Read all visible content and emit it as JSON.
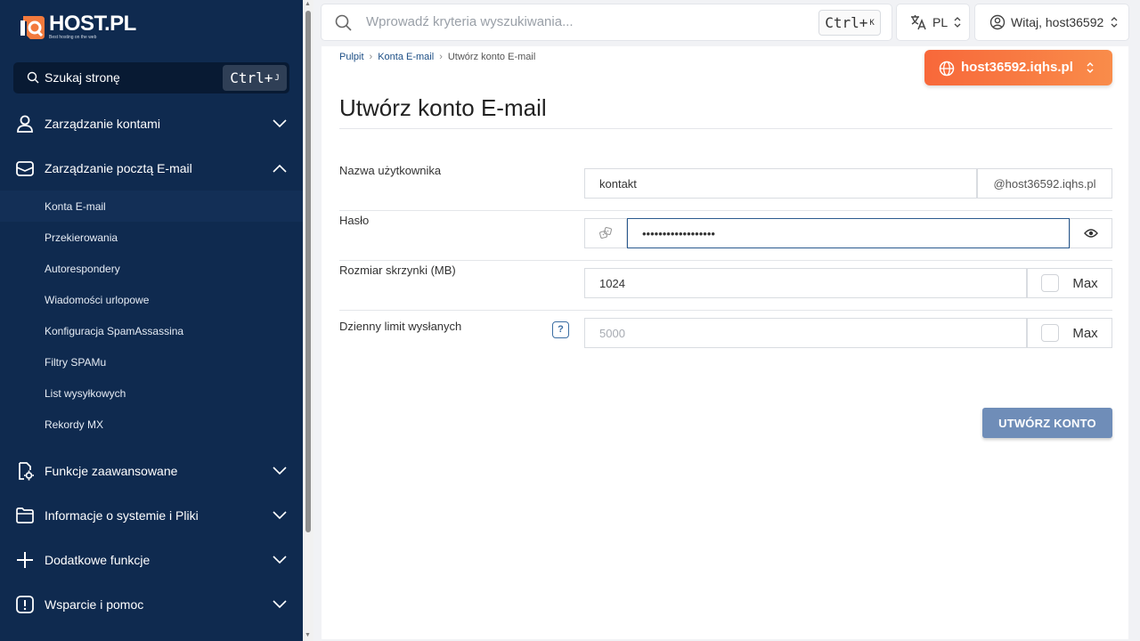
{
  "logo": {
    "name": "HOST.PL",
    "tagline": "Best hosting on the web"
  },
  "sidebar": {
    "search_label": "Szukaj stronę",
    "search_shortcut": "Ctrl+",
    "search_shortcut_key": "J",
    "sections": [
      {
        "label": "Zarządzanie kontami",
        "icon": "user-icon",
        "expanded": false
      },
      {
        "label": "Zarządzanie pocztą E-mail",
        "icon": "envelope-icon",
        "expanded": true
      },
      {
        "label": "Funkcje zaawansowane",
        "icon": "advanced-settings-icon",
        "expanded": false
      },
      {
        "label": "Informacje o systemie i Pliki",
        "icon": "folder-icon",
        "expanded": false
      },
      {
        "label": "Dodatkowe funkcje",
        "icon": "plus-icon",
        "expanded": false
      },
      {
        "label": "Wsparcie i pomoc",
        "icon": "exclamation-icon",
        "expanded": false
      }
    ],
    "email_items": [
      {
        "label": "Konta E-mail",
        "active": true
      },
      {
        "label": "Przekierowania"
      },
      {
        "label": "Autorespondery"
      },
      {
        "label": "Wiadomości urlopowe"
      },
      {
        "label": "Konfiguracja SpamAssassina"
      },
      {
        "label": "Filtry SPAMu"
      },
      {
        "label": "List wysyłkowych"
      },
      {
        "label": "Rekordy MX"
      }
    ]
  },
  "topbar": {
    "search_placeholder": "Wprowadź kryteria wyszukiwania...",
    "search_shortcut": "Ctrl+",
    "search_shortcut_key": "K",
    "language": "PL",
    "greeting": "Witaj, host36592"
  },
  "breadcrumb": [
    "Pulpit",
    "Konta E-mail",
    "Utwórz konto E-mail"
  ],
  "domain_selector": "host36592.iqhs.pl",
  "page": {
    "title": "Utwórz konto E-mail",
    "fields": {
      "username": {
        "label": "Nazwa użytkownika",
        "value": "kontakt",
        "suffix": "@host36592.iqhs.pl"
      },
      "password": {
        "label": "Hasło",
        "value": "••••••••••••••••••"
      },
      "mailbox_size": {
        "label": "Rozmiar skrzynki (MB)",
        "value": "1024",
        "max_label": "Max",
        "max_checked": false
      },
      "daily_limit": {
        "label": "Dzienny limit wysłanych",
        "help": "?",
        "placeholder": "5000",
        "max_label": "Max",
        "max_checked": false
      }
    },
    "submit_label": "UTWÓRZ KONTO"
  },
  "colors": {
    "sidebar_bg": "#0f2a4f",
    "accent_orange": "#f8683a",
    "primary_button": "#6f8db8",
    "link": "#1d4f86"
  }
}
